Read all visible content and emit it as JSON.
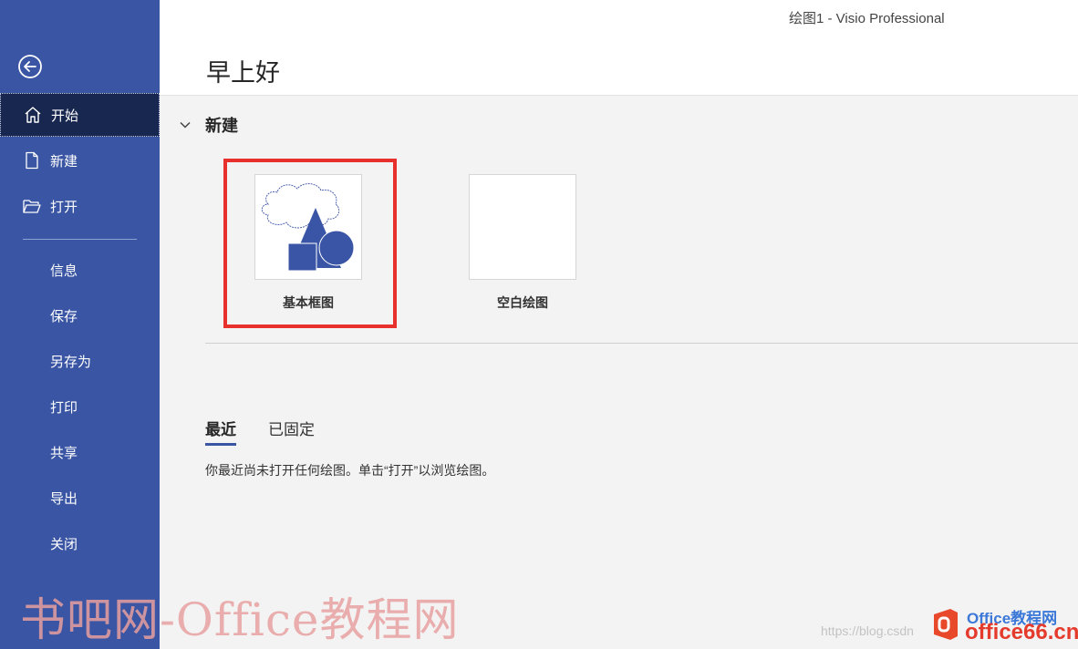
{
  "window": {
    "title": "绘图1  -  Visio Professional"
  },
  "sidebar": {
    "items": [
      {
        "label": "开始",
        "icon": "home-icon"
      },
      {
        "label": "新建",
        "icon": "new-document-icon"
      },
      {
        "label": "打开",
        "icon": "open-folder-icon"
      },
      {
        "label": "信息"
      },
      {
        "label": "保存"
      },
      {
        "label": "另存为"
      },
      {
        "label": "打印"
      },
      {
        "label": "共享"
      },
      {
        "label": "导出"
      },
      {
        "label": "关闭"
      }
    ],
    "back_icon": "back-arrow-icon"
  },
  "main": {
    "greeting": "早上好",
    "new_section": {
      "title": "新建",
      "templates": [
        {
          "label": "基本框图",
          "thumbnail": "basic-shapes"
        },
        {
          "label": "空白绘图",
          "thumbnail": "blank"
        }
      ]
    },
    "tabs": [
      {
        "label": "最近",
        "active": true
      },
      {
        "label": "已固定",
        "active": false
      }
    ],
    "empty_message": "你最近尚未打开任何绘图。单击“打开”以浏览绘图。"
  },
  "watermark": {
    "text_cn": "书吧网-Office教程网",
    "url": "https://blog.csdn",
    "brand_top": "Office教程网",
    "brand_bottom": "office66.cn"
  },
  "colors": {
    "sidebar": "#3955a3",
    "sidebar_active": "#18274f",
    "highlight": "#e8302d",
    "shape_fill": "#3b55a6"
  }
}
